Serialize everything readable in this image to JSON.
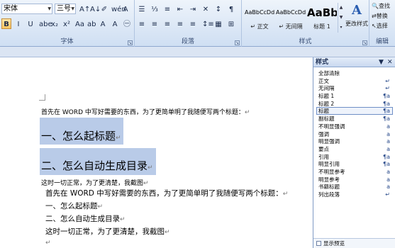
{
  "ribbon": {
    "font_group": {
      "title": "字体",
      "font_name": "宋体",
      "font_size": "三号",
      "row1": [
        {
          "name": "grow-font-button",
          "label": "A↑"
        },
        {
          "name": "shrink-font-button",
          "label": "A↓"
        },
        {
          "name": "clear-format-button",
          "label": "✐"
        },
        {
          "name": "phonetic-guide-button",
          "label": "wén"
        },
        {
          "name": "char-border-button",
          "label": "A"
        }
      ],
      "row2": [
        {
          "name": "bold-button",
          "label": "B"
        },
        {
          "name": "italic-button",
          "label": "I"
        },
        {
          "name": "underline-button",
          "label": "U"
        },
        {
          "name": "strikethrough-button",
          "label": "abe"
        },
        {
          "name": "subscript-button",
          "label": "x₂"
        },
        {
          "name": "superscript-button",
          "label": "x²"
        },
        {
          "name": "change-case-button",
          "label": "Aa"
        },
        {
          "name": "highlight-button",
          "label": "ab"
        },
        {
          "name": "font-color-button",
          "label": "A"
        },
        {
          "name": "char-shading-button",
          "label": "A"
        },
        {
          "name": "enclose-char-button",
          "label": "㊀"
        }
      ]
    },
    "paragraph_group": {
      "title": "段落",
      "row1": [
        {
          "name": "bullets-button",
          "label": "☰"
        },
        {
          "name": "numbering-button",
          "label": "⅓"
        },
        {
          "name": "multilevel-button",
          "label": "≡"
        },
        {
          "name": "decrease-indent-button",
          "label": "⇤"
        },
        {
          "name": "increase-indent-button",
          "label": "⇥"
        },
        {
          "name": "asian-layout-button",
          "label": "✕"
        },
        {
          "name": "sort-button",
          "label": "↕"
        },
        {
          "name": "show-marks-button",
          "label": "¶"
        }
      ],
      "row2": [
        {
          "name": "align-left-button",
          "label": "≡"
        },
        {
          "name": "align-center-button",
          "label": "≡"
        },
        {
          "name": "align-right-button",
          "label": "≡"
        },
        {
          "name": "justify-button",
          "label": "≡"
        },
        {
          "name": "distributed-button",
          "label": "≡"
        },
        {
          "name": "line-spacing-button",
          "label": "↕≡"
        },
        {
          "name": "shading-button",
          "label": "▦"
        },
        {
          "name": "borders-button",
          "label": "⊞"
        }
      ]
    },
    "styles_group": {
      "title": "样式",
      "tiles": [
        {
          "sample": "AaBbCcDd",
          "caption": "↵ 正文"
        },
        {
          "sample": "AaBbCcDd",
          "caption": "↵ 无间隔"
        },
        {
          "sample": "AaBb",
          "caption": "标题 1"
        }
      ],
      "change_styles": "更改样式",
      "change_icon": "A"
    },
    "edit_group": {
      "title": "编辑",
      "items": [
        "查找",
        "替换",
        "选择"
      ]
    }
  },
  "document": {
    "paragraphs": [
      {
        "text": "首先在 WORD 中写好需要的东西，为了更简单明了我随便写两个标题：",
        "mark": "↵"
      },
      {
        "text": "一、怎么起标题",
        "mark": "↵"
      },
      {
        "text": "二、怎么自动生成目录",
        "mark": "↵"
      },
      {
        "text": "这时一切正常，为了更清楚，我截图",
        "mark": "↵"
      },
      {
        "text": "首先在 WORD 中写好需要的东西，为了更简单明了我随便写两个标题：",
        "mark": "↵"
      },
      {
        "text": "一、怎么起标题",
        "mark": "↵"
      },
      {
        "text": "二、怎么自动生成目录",
        "mark": "↵"
      },
      {
        "text": "这时一切正常，为了更清楚，我截图",
        "mark": "↵"
      },
      {
        "text": "",
        "mark": "↵"
      }
    ]
  },
  "styles_pane": {
    "title": "样式",
    "pin": "▼",
    "close": "✕",
    "items": [
      {
        "label": "全部清除",
        "glyph": ""
      },
      {
        "label": "正文",
        "glyph": "↵"
      },
      {
        "label": "无间隔",
        "glyph": "↵"
      },
      {
        "label": "标题 1",
        "glyph": "¶a"
      },
      {
        "label": "标题 2",
        "glyph": "¶a"
      },
      {
        "label": "标题",
        "glyph": "¶a"
      },
      {
        "label": "副标题",
        "glyph": "¶a"
      },
      {
        "label": "不明显强调",
        "glyph": "a"
      },
      {
        "label": "强调",
        "glyph": "a"
      },
      {
        "label": "明显强调",
        "glyph": "a"
      },
      {
        "label": "要点",
        "glyph": "a"
      },
      {
        "label": "引用",
        "glyph": "¶a"
      },
      {
        "label": "明显引用",
        "glyph": "¶a"
      },
      {
        "label": "不明显参考",
        "glyph": "a"
      },
      {
        "label": "明显参考",
        "glyph": "a"
      },
      {
        "label": "书籍标题",
        "glyph": "a"
      },
      {
        "label": "列出段落",
        "glyph": "↵"
      }
    ],
    "show_preview": "显示预览"
  }
}
